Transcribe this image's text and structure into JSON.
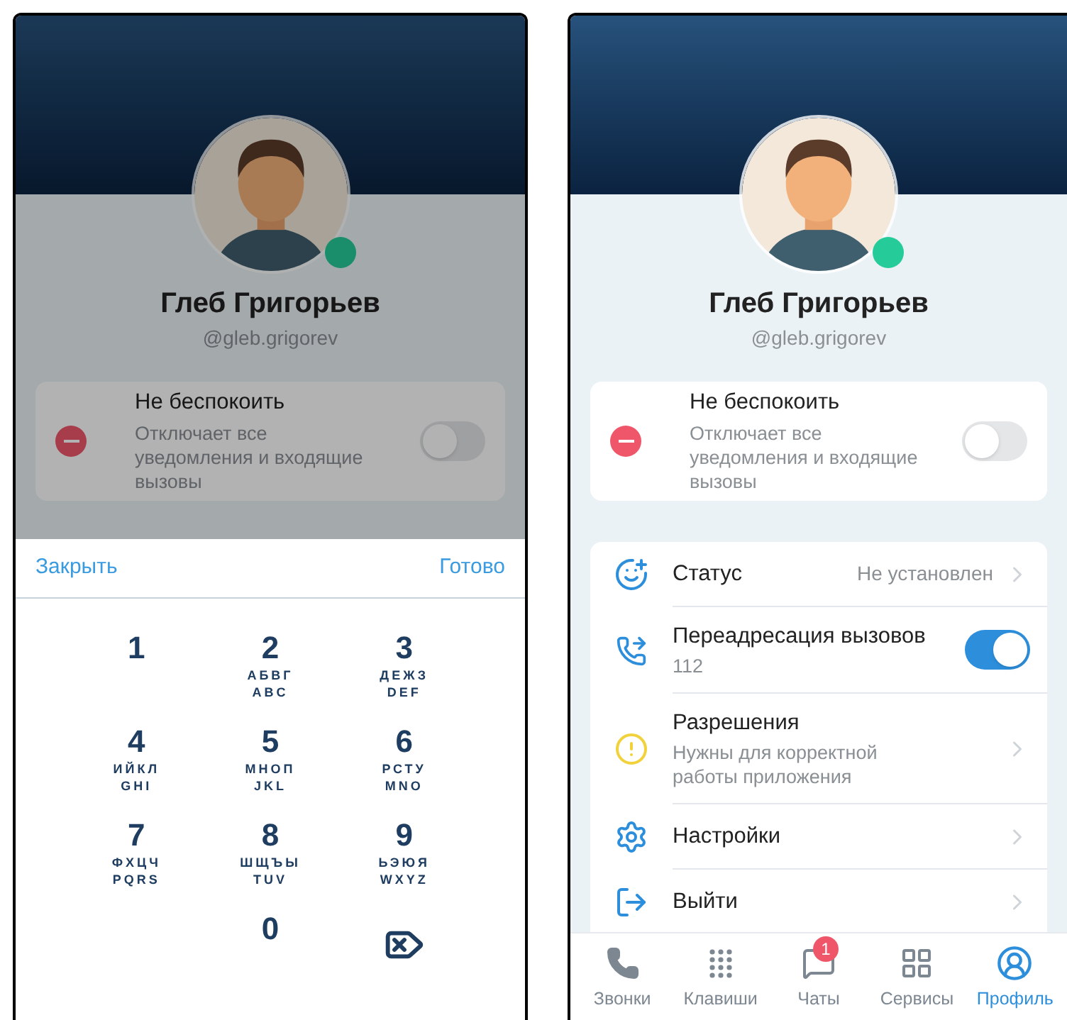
{
  "screens": [
    {
      "dimmed": true,
      "profile": {
        "name": "Глеб Григорьев",
        "handle": "@gleb.grigorev",
        "online": true
      },
      "dnd": {
        "title": "Не беспокоить",
        "description": "Отключает все уведомления и входящие вызовы",
        "on": false
      },
      "dialpad": {
        "close": "Закрыть",
        "done": "Готово",
        "keys": [
          {
            "kind": "digit",
            "digit": "1"
          },
          {
            "kind": "digit",
            "digit": "2",
            "letters": [
              "АБВГ",
              "ABC"
            ]
          },
          {
            "kind": "digit",
            "digit": "3",
            "letters": [
              "ДЕЖЗ",
              "DEF"
            ]
          },
          {
            "kind": "digit",
            "digit": "4",
            "letters": [
              "ИЙКЛ",
              "GHI"
            ]
          },
          {
            "kind": "digit",
            "digit": "5",
            "letters": [
              "МНОП",
              "JKL"
            ]
          },
          {
            "kind": "digit",
            "digit": "6",
            "letters": [
              "РСТУ",
              "MNO"
            ]
          },
          {
            "kind": "digit",
            "digit": "7",
            "letters": [
              "ФХЦЧ",
              "PQRS"
            ]
          },
          {
            "kind": "digit",
            "digit": "8",
            "letters": [
              "ШЩЪЫ",
              "TUV"
            ]
          },
          {
            "kind": "digit",
            "digit": "9",
            "letters": [
              "ЬЭЮЯ",
              "WXYZ"
            ]
          },
          {
            "kind": "blank"
          },
          {
            "kind": "digit",
            "digit": "0"
          },
          {
            "kind": "backspace"
          }
        ]
      }
    },
    {
      "dimmed": false,
      "profile": {
        "name": "Глеб Григорьев",
        "handle": "@gleb.grigorev",
        "online": true
      },
      "dnd": {
        "title": "Не беспокоить",
        "description": "Отключает все уведомления и входящие вызовы",
        "on": false
      },
      "menu": [
        {
          "kind": "value",
          "label": "Статус",
          "value": "Не установлен"
        },
        {
          "kind": "toggle",
          "label": "Переадресация вызовов",
          "subtitle": "112",
          "on": true
        },
        {
          "kind": "link",
          "label": "Разрешения",
          "subtitle": "Нужны для корректной работы приложения"
        },
        {
          "kind": "link",
          "label": "Настройки"
        },
        {
          "kind": "link",
          "label": "Выйти"
        }
      ],
      "tabbar": [
        {
          "label": "Звонки",
          "selected": false
        },
        {
          "label": "Клавиши",
          "selected": false
        },
        {
          "label": "Чаты",
          "selected": false,
          "badge": "1"
        },
        {
          "label": "Сервисы",
          "selected": false
        },
        {
          "label": "Профиль",
          "selected": true
        }
      ]
    }
  ]
}
